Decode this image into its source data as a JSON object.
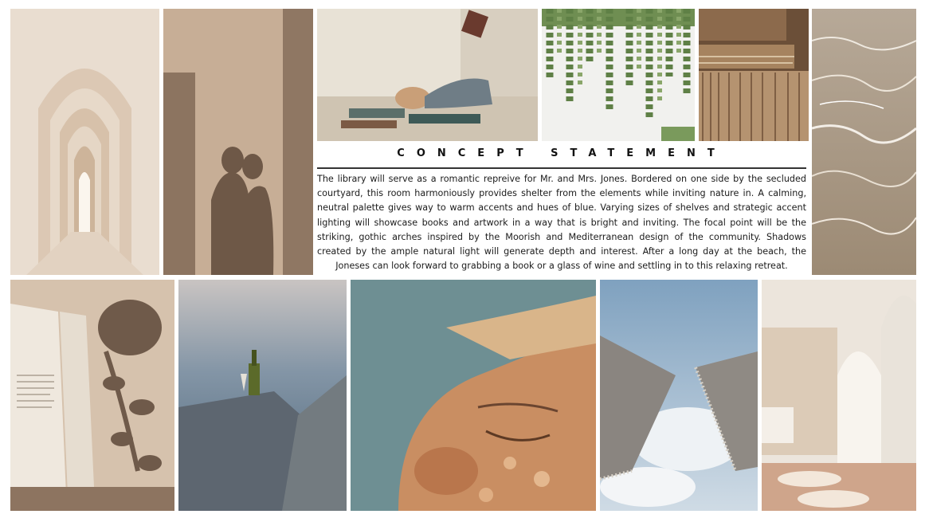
{
  "statement": {
    "heading": "CONCEPT STATEMENT",
    "body": "The library will serve as a romantic repreive for Mr. and Mrs. Jones. Bordered on one side by the secluded courtyard, this room harmoniously provides shelter from the elements while inviting nature in.  A calming, neutral palette gives way to warm accents and hues of blue. Varying sizes of shelves and strategic accent lighting will showcase books and artwork in a way that is bright and inviting. The focal point will be the striking, gothic arches inspired by the Moorish and Mediterranean design of the community. Shadows created by the ample natural light will generate depth and interest. After a long day at the beach, the Joneses can look forward to grabbing a book or a glass of wine and settling in to this relaxing retreat."
  },
  "palette": {
    "background": "#ffffff",
    "beige": "#d8c6b3",
    "tan": "#b79a80",
    "sky": "#9bb8cf",
    "water": "#5f7b92",
    "text": "#1b1b1b"
  },
  "images": [
    {
      "name": "arched-corridor-photo"
    },
    {
      "name": "couple-shadow-photo"
    },
    {
      "name": "woman-reading-painting"
    },
    {
      "name": "hanging-ivy-wall-photo"
    },
    {
      "name": "old-books-photo"
    },
    {
      "name": "shallow-water-photo"
    },
    {
      "name": "book-leaf-shadow-photo"
    },
    {
      "name": "wine-bottle-on-rock-photo"
    },
    {
      "name": "sunlit-face-photo"
    },
    {
      "name": "fringed-umbrellas-photo"
    },
    {
      "name": "white-arches-courtyard-photo"
    }
  ]
}
